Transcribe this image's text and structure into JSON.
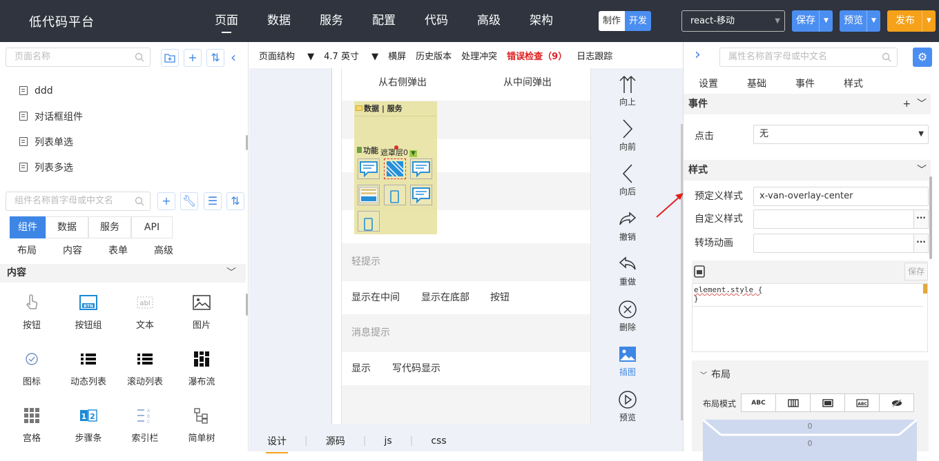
{
  "app": {
    "title": "低代码平台"
  },
  "nav": [
    "页面",
    "数据",
    "服务",
    "配置",
    "代码",
    "高级",
    "架构"
  ],
  "mode": {
    "make": "制作",
    "dev": "开发"
  },
  "project_select": "react-移动",
  "actions": {
    "save": "保存",
    "preview": "预览",
    "publish": "发布"
  },
  "left": {
    "page_search_placeholder": "页面名称",
    "pages": [
      "ddd",
      "对话框组件",
      "列表单选",
      "列表多选"
    ],
    "component_search_placeholder": "组件名称首字母或中文名",
    "tabs": [
      "组件",
      "数据",
      "服务",
      "API"
    ],
    "subtabs": [
      "布局",
      "内容",
      "表单",
      "高级"
    ],
    "section": "内容",
    "components": [
      "按钮",
      "按钮组",
      "文本",
      "图片",
      "图标",
      "动态列表",
      "滚动列表",
      "瀑布流",
      "宫格",
      "步骤条",
      "索引栏",
      "简单树"
    ]
  },
  "center": {
    "toolbar": {
      "structure": "页面结构",
      "device": "4.7 英寸",
      "landscape": "横屏",
      "history": "历史版本",
      "conflict": "处理冲突",
      "errors": "错误检查（9）",
      "log": "日志跟踪"
    },
    "phone": {
      "row1a": "从右侧弹出",
      "row1b": "从中间弹出",
      "overlay_header": "数据 | 服务",
      "overlay_func": "功能",
      "overlay_mask": "遮罩层0",
      "toast_title": "轻提示",
      "toast_btns": [
        "显示在中间",
        "显示在底部",
        "按钮"
      ],
      "msg_title": "消息提示",
      "msg_btns": [
        "显示",
        "写代码显示"
      ]
    },
    "side": [
      "向上",
      "向前",
      "向后",
      "撤销",
      "重做",
      "删除",
      "插图",
      "预览"
    ],
    "bottom_tabs": [
      "设计",
      "源码",
      "js",
      "css"
    ]
  },
  "right": {
    "search_placeholder": "属性名称首字母或中文名",
    "tabs": [
      "设置",
      "基础",
      "事件",
      "样式"
    ],
    "events_title": "事件",
    "click_label": "点击",
    "click_value": "无",
    "style_title": "样式",
    "predefined_label": "预定义样式",
    "predefined_value": "x-van-overlay-center",
    "custom_label": "自定义样式",
    "transition_label": "转场动画",
    "editor_save": "保存",
    "editor_line1": "element.style {",
    "editor_line2": "}",
    "layout_title": "布局",
    "layout_mode_label": "布局模式",
    "layout_modes": [
      "ABC",
      "",
      "",
      "ABC",
      ""
    ],
    "box_values": [
      "0",
      "0"
    ]
  },
  "colors": {
    "accent": "#3e86e5",
    "topbar": "#2f343e",
    "publish": "#f5a11a",
    "error": "#e02020"
  }
}
